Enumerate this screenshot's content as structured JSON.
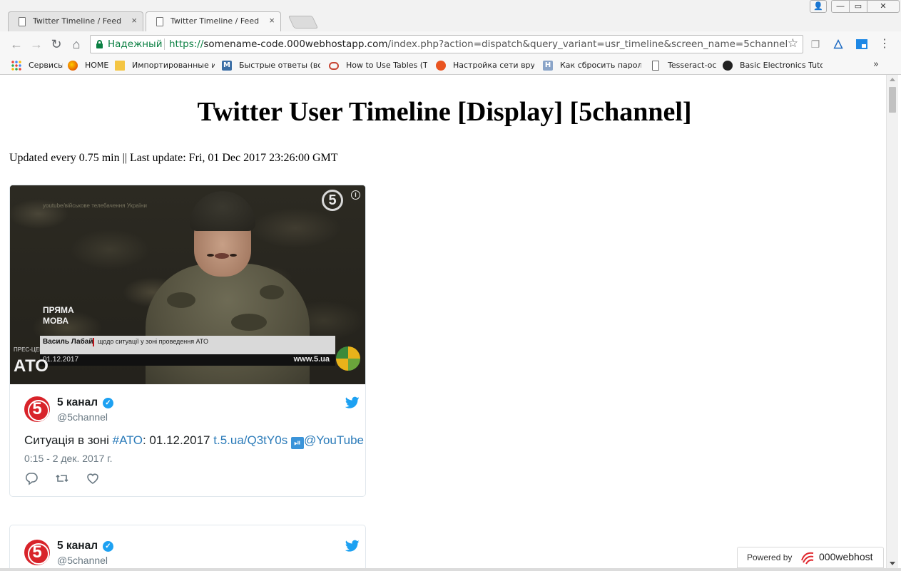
{
  "browser": {
    "tabs": [
      {
        "title": "Twitter Timeline / Feed",
        "close": "×"
      },
      {
        "title": "Twitter Timeline / Feed",
        "close": "×"
      }
    ],
    "secure_label": "Надежный",
    "url_scheme": "https://",
    "url_host": "somename-code.000webhostapp.com",
    "url_path": "/index.php?action=dispatch&query_variant=usr_timeline&screen_name=5channel",
    "window_buttons": {
      "user": "👤",
      "min": "—",
      "max": "▭",
      "close": "✕"
    },
    "bookmarks": [
      {
        "label": "Сервисы",
        "icon": "apps-icon",
        "color": "#4285f4"
      },
      {
        "label": "HOME",
        "icon": "firefox-icon",
        "color": "#e66000"
      },
      {
        "label": "Импортированные из",
        "icon": "folder-icon",
        "color": "#f4c542"
      },
      {
        "label": "Быстрые ответы (вопр",
        "icon": "m-icon",
        "color": "#3b6ea5"
      },
      {
        "label": "How to Use Tables (Th",
        "icon": "oracle-icon",
        "color": "#c74634"
      },
      {
        "label": "Настройка сети вручн",
        "icon": "ubuntu-icon",
        "color": "#e95420"
      },
      {
        "label": "Как сбросить пароль в",
        "icon": "h-icon",
        "color": "#8aa4c8"
      },
      {
        "label": "Tesseract-ocr",
        "icon": "page-icon",
        "color": "#ffffff"
      },
      {
        "label": "Basic Electronics Tutori",
        "icon": "wave-icon",
        "color": "#222222"
      }
    ],
    "bookmarks_more": "»"
  },
  "page": {
    "title": "Twitter User Timeline [Display] [5channel]",
    "update_line": "Updated every 0.75 min || Last update: Fri, 01 Dec 2017 23:26:00 GMT"
  },
  "tweets": [
    {
      "media": {
        "watermark": "youtube/військове телебачення України",
        "logo": "5",
        "caption_title": "ПРЯМА\nМОВА",
        "caption_name": "Василь Лабай",
        "caption_desc": "щодо ситуації у зоні проведення АТО",
        "caption_date": "01.12.2017",
        "caption_site": "www.5.ua",
        "caption_ato": "АТО",
        "caption_press": "ПРЕС-ЦЕН ШТАБ"
      },
      "avatar": "5",
      "display_name": "5 канал",
      "handle": "@5channel",
      "text_before": "Ситуація в зоні ",
      "hashtag": "#АТО",
      "text_mid": ": 01.12.2017 ",
      "link": "t.5.ua/Q3tY0s",
      "play": "⏯",
      "mention": "@YouTube",
      "time": "0:15 - 2 дек. 2017 г."
    },
    {
      "avatar": "5",
      "display_name": "5 канал",
      "handle": "@5channel"
    }
  ],
  "powered": {
    "label": "Powered by",
    "brand": "000webhost"
  },
  "colors": {
    "link": "#2b7bb9",
    "twitter_blue": "#1da1f2",
    "secure_green": "#0b8043",
    "channel_red": "#d8232a"
  }
}
